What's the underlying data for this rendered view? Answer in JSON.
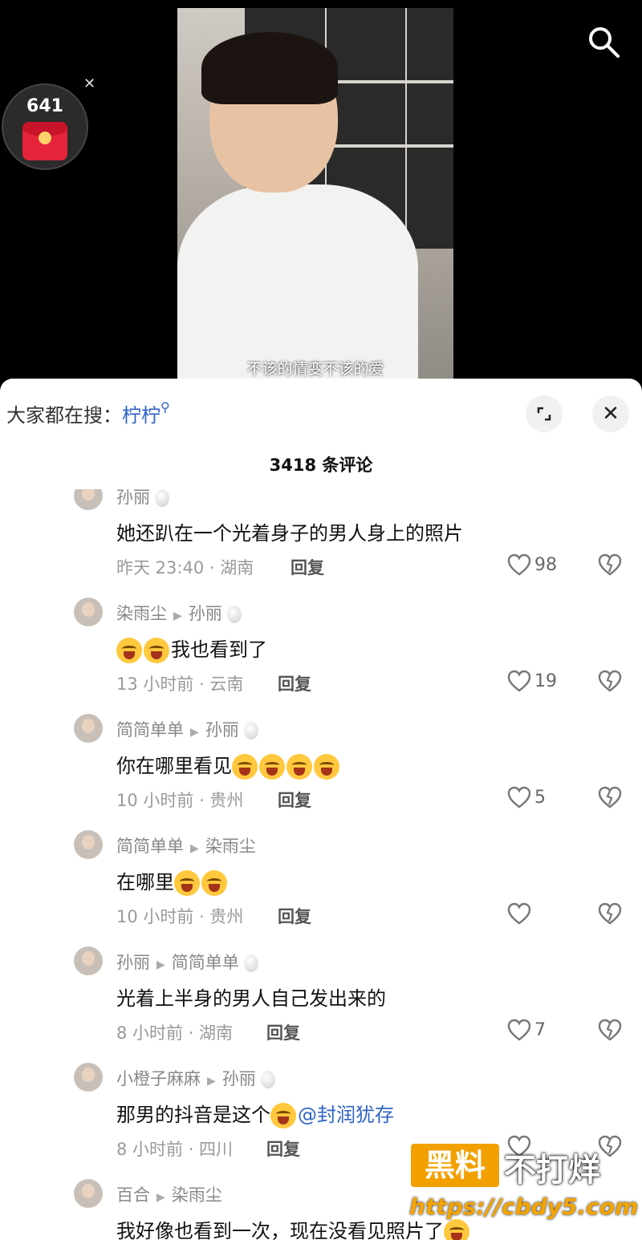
{
  "video": {
    "subtitle": "不该的情变不该的爱"
  },
  "red_packet": {
    "count": "641"
  },
  "trending": {
    "prefix": "大家都在搜：",
    "keyword": "柠柠"
  },
  "comments_header": {
    "title": "3418 条评论"
  },
  "comments": [
    {
      "author": "孙丽",
      "reply_to": "",
      "text": "她还趴在一个光着身子的男人身上的照片",
      "emoji_count": 0,
      "mention": "",
      "time": "昨天 23:40 · 湖南",
      "reply_label": "回复",
      "likes": "98"
    },
    {
      "author": "染雨尘",
      "reply_to": "孙丽",
      "text": "我也看到了",
      "emoji_count": 2,
      "mention": "",
      "time": "13 小时前 · 云南",
      "reply_label": "回复",
      "likes": "19"
    },
    {
      "author": "简简单单",
      "reply_to": "孙丽",
      "text": "你在哪里看见",
      "emoji_count": 4,
      "mention": "",
      "time": "10 小时前 · 贵州",
      "reply_label": "回复",
      "likes": "5"
    },
    {
      "author": "简简单单",
      "reply_to": "染雨尘",
      "text": "在哪里",
      "emoji_count": 2,
      "mention": "",
      "time": "10 小时前 · 贵州",
      "reply_label": "回复",
      "likes": ""
    },
    {
      "author": "孙丽",
      "reply_to": "简简单单",
      "text": "光着上半身的男人自己发出来的",
      "emoji_count": 0,
      "mention": "",
      "time": "8 小时前 · 湖南",
      "reply_label": "回复",
      "likes": "7"
    },
    {
      "author": "小橙子麻麻",
      "reply_to": "孙丽",
      "text": "那男的抖音是这个",
      "emoji_count": 1,
      "mention": "@封润犹存",
      "time": "8 小时前 · 四川",
      "reply_label": "回复",
      "likes": ""
    },
    {
      "author": "百合",
      "reply_to": "染雨尘",
      "text": "我好像也看到一次，现在没看见照片了",
      "emoji_count": 1,
      "mention": "",
      "time": "",
      "reply_label": "",
      "likes": ""
    }
  ],
  "watermark": {
    "box": "黑料",
    "text": "不打烊",
    "url": "https://cbdy5.com"
  },
  "colors": {
    "accent": "#2f63c5",
    "watermark": "#f2a000"
  }
}
